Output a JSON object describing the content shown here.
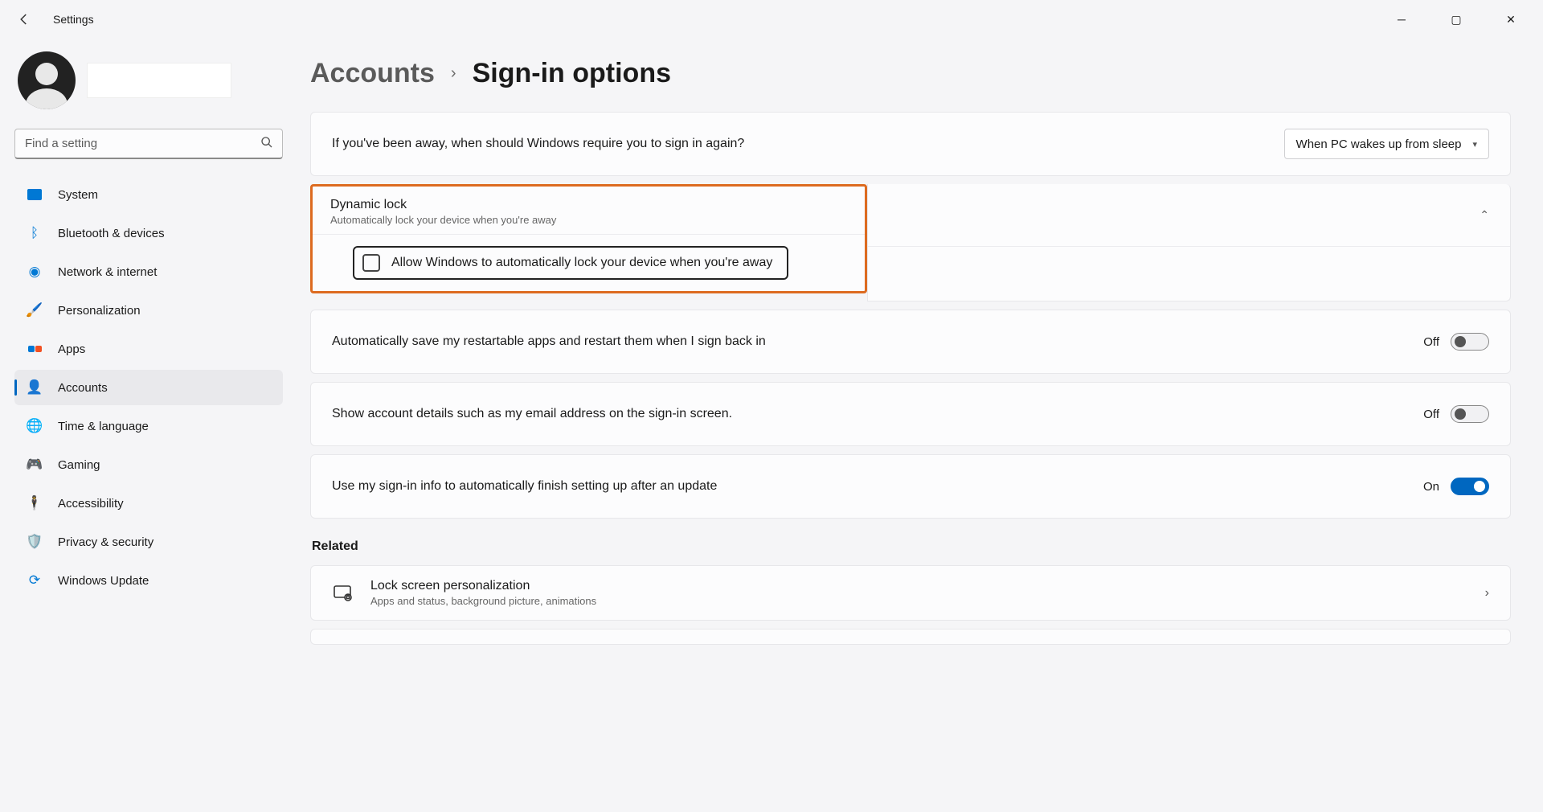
{
  "titlebar": {
    "title": "Settings"
  },
  "search": {
    "placeholder": "Find a setting"
  },
  "nav": {
    "items": [
      {
        "label": "System"
      },
      {
        "label": "Bluetooth & devices"
      },
      {
        "label": "Network & internet"
      },
      {
        "label": "Personalization"
      },
      {
        "label": "Apps"
      },
      {
        "label": "Accounts"
      },
      {
        "label": "Time & language"
      },
      {
        "label": "Gaming"
      },
      {
        "label": "Accessibility"
      },
      {
        "label": "Privacy & security"
      },
      {
        "label": "Windows Update"
      }
    ]
  },
  "breadcrumb": {
    "parent": "Accounts",
    "current": "Sign-in options"
  },
  "main": {
    "require_signin_question": "If you've been away, when should Windows require you to sign in again?",
    "require_signin_value": "When PC wakes up from sleep",
    "dynamic_lock": {
      "title": "Dynamic lock",
      "subtitle": "Automatically lock your device when you're away",
      "checkbox_label": "Allow Windows to automatically lock your device when you're away"
    },
    "restart_apps": {
      "label": "Automatically save my restartable apps and restart them when I sign back in",
      "state": "Off"
    },
    "show_account": {
      "label": "Show account details such as my email address on the sign-in screen.",
      "state": "Off"
    },
    "use_signin_info": {
      "label": "Use my sign-in info to automatically finish setting up after an update",
      "state": "On"
    },
    "related_title": "Related",
    "related": {
      "lockscreen": {
        "title": "Lock screen personalization",
        "subtitle": "Apps and status, background picture, animations"
      }
    }
  }
}
